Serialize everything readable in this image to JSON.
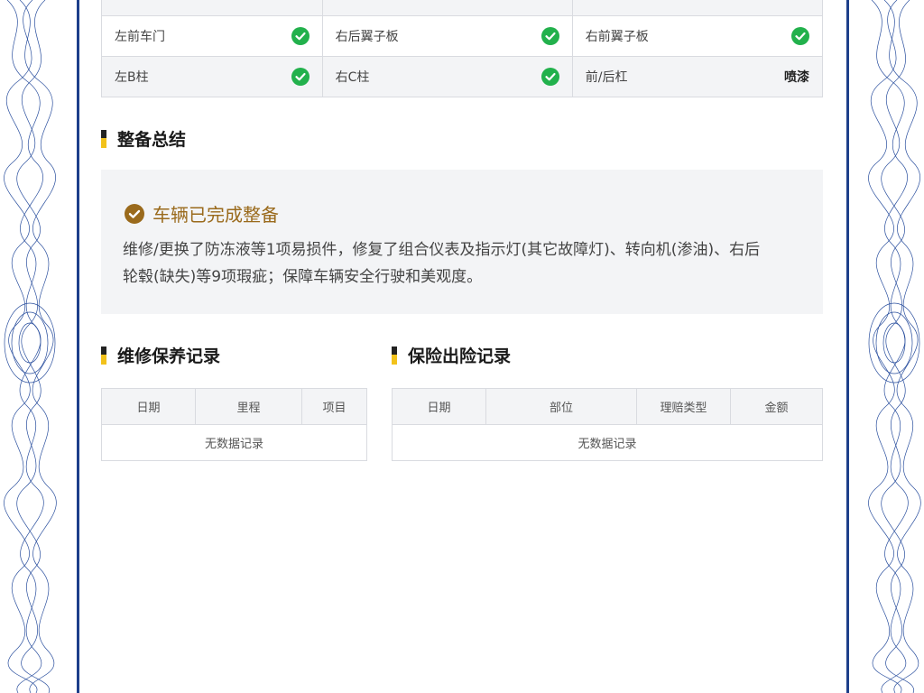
{
  "inspection": {
    "rows": [
      [
        {
          "label": "左前车门",
          "status": "ok",
          "status_text": ""
        },
        {
          "label": "右后翼子板",
          "status": "ok",
          "status_text": ""
        },
        {
          "label": "右前翼子板",
          "status": "ok",
          "status_text": ""
        }
      ],
      [
        {
          "label": "左B柱",
          "status": "ok",
          "status_text": ""
        },
        {
          "label": "右C柱",
          "status": "ok",
          "status_text": ""
        },
        {
          "label": "前/后杠",
          "status": "text",
          "status_text": "喷漆"
        }
      ]
    ],
    "ok_color": "#22b14c"
  },
  "summary": {
    "title": "整备总结",
    "headline": "车辆已完成整备",
    "headline_color": "#9a6a1c",
    "text": "维修/更换了防冻液等1项易损件，修复了组合仪表及指示灯(其它故障灯)、转向机(渗油)、右后轮毂(缺失)等9项瑕疵；保障车辆安全行驶和美观度。"
  },
  "maintenance": {
    "title": "维修保养记录",
    "columns": [
      "日期",
      "里程",
      "项目"
    ],
    "empty": "无数据记录"
  },
  "insurance": {
    "title": "保险出险记录",
    "columns": [
      "日期",
      "部位",
      "理赔类型",
      "金额"
    ],
    "empty": "无数据记录"
  },
  "colors": {
    "frame": "#1d3f8a",
    "accent_yellow": "#f2c21b"
  }
}
